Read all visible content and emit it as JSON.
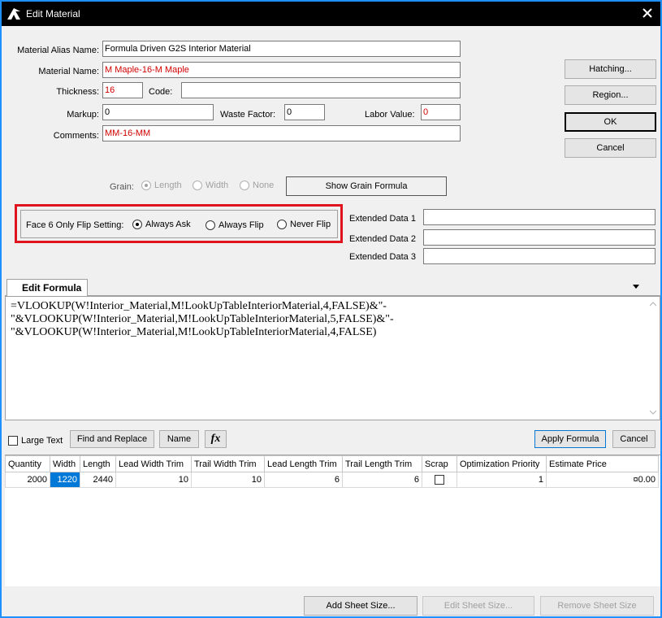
{
  "window": {
    "title": "Edit Material"
  },
  "form": {
    "alias_label": "Material Alias Name:",
    "alias_value": "Formula Driven G2S Interior Material",
    "name_label": "Material Name:",
    "name_value": "M Maple-16-M Maple",
    "thickness_label": "Thickness:",
    "thickness_value": "16",
    "code_label": "Code:",
    "code_value": "",
    "markup_label": "Markup:",
    "markup_value": "0",
    "waste_label": "Waste Factor:",
    "waste_value": "0",
    "labor_label": "Labor Value:",
    "labor_value": "0",
    "comments_label": "Comments:",
    "comments_value": "MM-16-MM"
  },
  "side_buttons": {
    "hatching": "Hatching...",
    "region": "Region...",
    "ok": "OK",
    "cancel": "Cancel"
  },
  "grain": {
    "label": "Grain:",
    "options": [
      "Length",
      "Width",
      "None"
    ],
    "selected": "Length",
    "button": "Show Grain Formula"
  },
  "flip": {
    "label": "Face 6 Only Flip Setting:",
    "options": [
      "Always Ask",
      "Always Flip",
      "Never Flip"
    ],
    "selected": "Always Ask",
    "highlight_color": "#e0141e"
  },
  "extended": [
    {
      "label": "Extended Data 1",
      "value": ""
    },
    {
      "label": "Extended Data 2",
      "value": ""
    },
    {
      "label": "Extended Data 3",
      "value": ""
    }
  ],
  "formula_tab": {
    "tab_label": "Edit Formula",
    "text": "=VLOOKUP(W!Interior_Material,M!LookUpTableInteriorMaterial,4,FALSE)&\"-\"&VLOOKUP(W!Interior_Material,M!LookUpTableInteriorMaterial,5,FALSE)&\"-\"&VLOOKUP(W!Interior_Material,M!LookUpTableInteriorMaterial,4,FALSE)"
  },
  "formula_toolbar": {
    "large_text": "Large Text",
    "find_replace": "Find and Replace",
    "name": "Name",
    "fx": "fx",
    "apply": "Apply Formula",
    "cancel": "Cancel"
  },
  "grid": {
    "columns": [
      "Quantity",
      "Width",
      "Length",
      "Lead Width Trim",
      "Trail Width Trim",
      "Lead Length Trim",
      "Trail Length Trim",
      "Scrap",
      "Optimization Priority",
      "Estimate Price"
    ],
    "rows": [
      {
        "quantity": "2000",
        "width": "1220",
        "length": "2440",
        "lead_width_trim": "10",
        "trail_width_trim": "10",
        "lead_length_trim": "6",
        "trail_length_trim": "6",
        "scrap": false,
        "priority": "1",
        "price": "¤0.00"
      }
    ]
  },
  "bottom_buttons": {
    "add": "Add Sheet Size...",
    "edit": "Edit Sheet Size...",
    "remove": "Remove Sheet Size"
  },
  "colors": {
    "accent": "#0078d7",
    "window_border": "#1e90ff",
    "titlebar": "#000000",
    "red_text": "#d00000"
  }
}
